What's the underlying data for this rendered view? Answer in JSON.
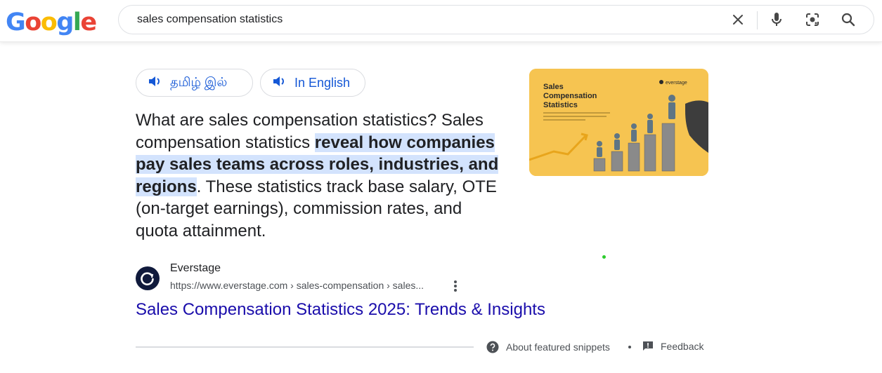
{
  "header": {
    "logo_letters": [
      "G",
      "o",
      "o",
      "g",
      "l",
      "e"
    ],
    "search": {
      "query": "sales compensation statistics",
      "icons": [
        "clear-icon",
        "microphone-icon",
        "lens-icon",
        "search-icon"
      ]
    }
  },
  "language_toggle": {
    "tamil_label": "தமிழ் இல்",
    "english_label": "In English",
    "icon": "speaker-icon"
  },
  "snippet": {
    "text_before": "What are sales compensation statistics? Sales compensation statistics ",
    "highlight": "reveal how companies pay sales teams across roles, industries, and regions",
    "text_after": ". These statistics track base salary, OTE (on-target earnings), commission rates, and quota attainment."
  },
  "thumbnail": {
    "title_line1": "Sales",
    "title_line2": "Compensation",
    "title_line3": "Statistics",
    "brand": "everstage",
    "background_color": "#f6c451"
  },
  "source": {
    "name": "Everstage",
    "url": "https://www.everstage.com › sales-compensation › sales...",
    "favicon_color": "#101a3c",
    "title": "Sales Compensation Statistics 2025: Trends & Insights"
  },
  "footer": {
    "about_label": "About featured snippets",
    "feedback_label": "Feedback"
  },
  "colors": {
    "link": "#1a0dab",
    "highlight": "#d3e3fd"
  }
}
